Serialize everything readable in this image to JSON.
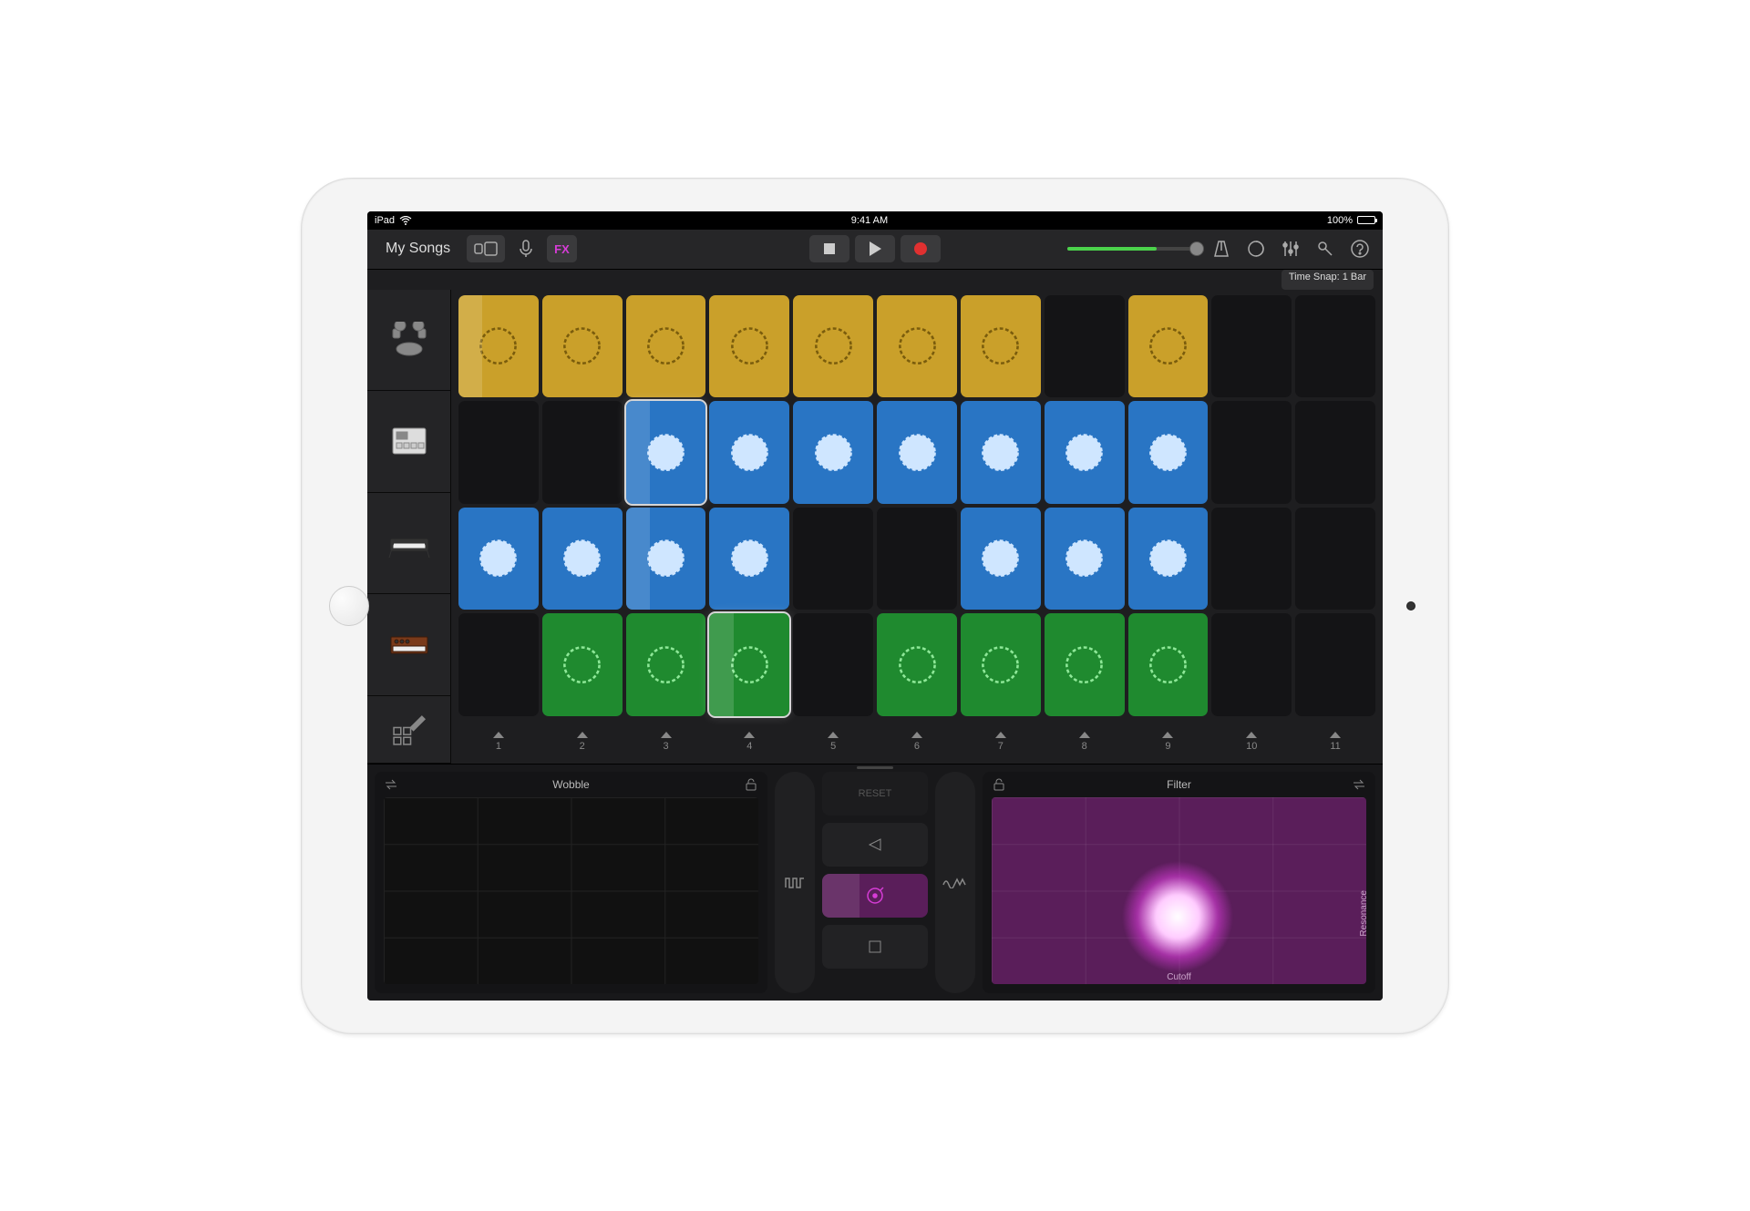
{
  "statusbar": {
    "device": "iPad",
    "time": "9:41 AM",
    "battery_text": "100%"
  },
  "toolbar": {
    "back_label": "My Songs",
    "fx_label": "FX"
  },
  "timesnap": {
    "label": "Time Snap: 1 Bar"
  },
  "tracks": [
    {
      "name": "Drum Kit"
    },
    {
      "name": "Drum Machine"
    },
    {
      "name": "Keyboard"
    },
    {
      "name": "Synth"
    }
  ],
  "columns": [
    "1",
    "2",
    "3",
    "4",
    "5",
    "6",
    "7",
    "8",
    "9",
    "10",
    "11"
  ],
  "grid": [
    [
      "yellow-p",
      "yellow",
      "yellow",
      "yellow",
      "yellow",
      "yellow",
      "yellow",
      "",
      "yellow",
      "",
      ""
    ],
    [
      "",
      "",
      "blue-a",
      "blue",
      "blue",
      "blue",
      "blue",
      "blue",
      "blue",
      "",
      ""
    ],
    [
      "blue",
      "blue",
      "blue-p",
      "blue",
      "",
      "",
      "blue",
      "blue",
      "blue",
      "",
      ""
    ],
    [
      "",
      "green",
      "green",
      "green-a",
      "",
      "green",
      "green",
      "green",
      "green",
      "",
      ""
    ]
  ],
  "fx": {
    "left": {
      "label": "Wobble"
    },
    "right": {
      "label": "Filter",
      "x_axis": "Cutoff",
      "y_axis": "Resonance"
    },
    "center": {
      "reset": "RESET"
    }
  }
}
